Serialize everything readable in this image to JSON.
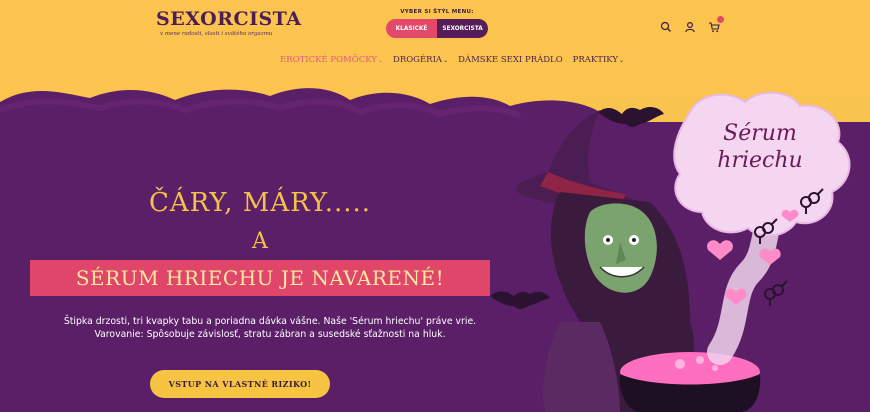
{
  "header": {
    "logo_text": "SEXORCISTA",
    "logo_tagline": "v mene radosti, slasti i svätého orgazmu",
    "menu_switch_label": "VYBER SI ŠTÝL MENU:",
    "menu_options": [
      "KLASICKÉ",
      "SEXORCISTA"
    ],
    "icons": [
      "search-icon",
      "user-icon",
      "cart-icon"
    ]
  },
  "nav": {
    "items": [
      {
        "label": "EROTICKÉ POMÔCKY",
        "has_dropdown": true,
        "active": true
      },
      {
        "label": "DROGÉRIA",
        "has_dropdown": true,
        "active": false
      },
      {
        "label": "DÁMSKE SEXI PRÁDLO",
        "has_dropdown": false,
        "active": false
      },
      {
        "label": "PRAKTIKY",
        "has_dropdown": true,
        "active": false
      }
    ],
    "caret": "⌄"
  },
  "hero": {
    "line1": "ČÁRY, MÁRY.....",
    "line2": "A",
    "line3": "SÉRUM HRIECHU JE NAVARENÉ!",
    "description_line1": "Štipka drzosti, tri kvapky tabu a poriadna dávka vášne. Naše 'Sérum hriechu' práve vrie.",
    "description_line2": "Varovanie: Spôsobuje závislosť, stratu zábran a susedské sťažnosti na hluk.",
    "cta_label": "VSTUP NA VLASTNÉ RIZIKO!",
    "bubble_line1": "Sérum",
    "bubble_line2": "hriechu"
  },
  "colors": {
    "header_bg": "#fac44e",
    "hero_bg": "#5b1f67",
    "accent_pink": "#e2496b",
    "accent_gold": "#f2c24b",
    "nav_text": "#4a1f4f"
  }
}
